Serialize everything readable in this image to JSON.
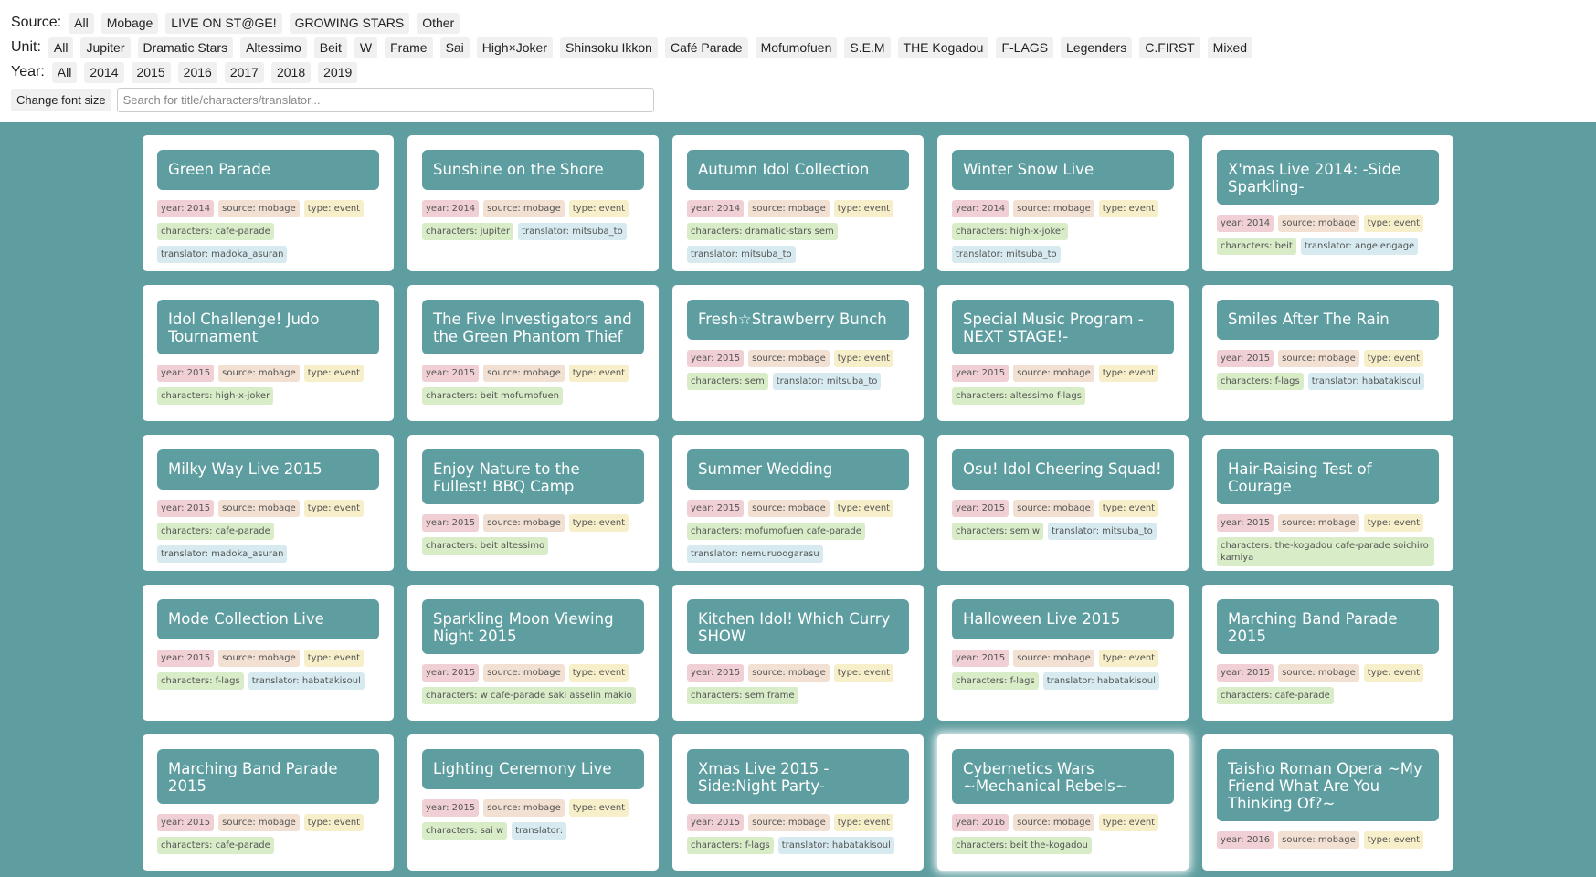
{
  "filters": {
    "source": {
      "label": "Source:",
      "options": [
        "All",
        "Mobage",
        "LIVE ON ST@GE!",
        "GROWING STARS",
        "Other"
      ]
    },
    "unit": {
      "label": "Unit:",
      "options": [
        "All",
        "Jupiter",
        "Dramatic Stars",
        "Altessimo",
        "Beit",
        "W",
        "Frame",
        "Sai",
        "High×Joker",
        "Shinsoku Ikkon",
        "Café Parade",
        "Mofumofuen",
        "S.E.M",
        "THE Kogadou",
        "F-LAGS",
        "Legenders",
        "C.FIRST",
        "Mixed"
      ]
    },
    "year": {
      "label": "Year:",
      "options": [
        "All",
        "2014",
        "2015",
        "2016",
        "2017",
        "2018",
        "2019"
      ]
    }
  },
  "toolbar": {
    "font_size_label": "Change font size",
    "search_placeholder": "Search for title/characters/translator..."
  },
  "cards": [
    {
      "title": "Green Parade",
      "tags": [
        {
          "k": "year",
          "t": "year: 2014"
        },
        {
          "k": "source",
          "t": "source: mobage"
        },
        {
          "k": "type",
          "t": "type: event"
        },
        {
          "k": "characters",
          "t": "characters: cafe-parade"
        },
        {
          "k": "translator",
          "t": "translator: madoka_asuran"
        }
      ]
    },
    {
      "title": "Sunshine on the Shore",
      "tags": [
        {
          "k": "year",
          "t": "year: 2014"
        },
        {
          "k": "source",
          "t": "source: mobage"
        },
        {
          "k": "type",
          "t": "type: event"
        },
        {
          "k": "characters",
          "t": "characters: jupiter"
        },
        {
          "k": "translator",
          "t": "translator: mitsuba_to"
        }
      ]
    },
    {
      "title": "Autumn Idol Collection",
      "tags": [
        {
          "k": "year",
          "t": "year: 2014"
        },
        {
          "k": "source",
          "t": "source: mobage"
        },
        {
          "k": "type",
          "t": "type: event"
        },
        {
          "k": "characters",
          "t": "characters: dramatic-stars sem"
        },
        {
          "k": "translator",
          "t": "translator: mitsuba_to"
        }
      ]
    },
    {
      "title": "Winter Snow Live",
      "tags": [
        {
          "k": "year",
          "t": "year: 2014"
        },
        {
          "k": "source",
          "t": "source: mobage"
        },
        {
          "k": "type",
          "t": "type: event"
        },
        {
          "k": "characters",
          "t": "characters: high-x-joker"
        },
        {
          "k": "translator",
          "t": "translator: mitsuba_to"
        }
      ]
    },
    {
      "title": "X'mas Live 2014: -Side Sparkling-",
      "tags": [
        {
          "k": "year",
          "t": "year: 2014"
        },
        {
          "k": "source",
          "t": "source: mobage"
        },
        {
          "k": "type",
          "t": "type: event"
        },
        {
          "k": "characters",
          "t": "characters: beit"
        },
        {
          "k": "translator",
          "t": "translator: angelengage"
        }
      ]
    },
    {
      "title": "Idol Challenge! Judo Tournament",
      "tags": [
        {
          "k": "year",
          "t": "year: 2015"
        },
        {
          "k": "source",
          "t": "source: mobage"
        },
        {
          "k": "type",
          "t": "type: event"
        },
        {
          "k": "characters",
          "t": "characters: high-x-joker"
        }
      ]
    },
    {
      "title": "The Five Investigators and the Green Phantom Thief",
      "tags": [
        {
          "k": "year",
          "t": "year: 2015"
        },
        {
          "k": "source",
          "t": "source: mobage"
        },
        {
          "k": "type",
          "t": "type: event"
        },
        {
          "k": "characters",
          "t": "characters: beit mofumofuen"
        }
      ]
    },
    {
      "title": "Fresh☆Strawberry Bunch",
      "tags": [
        {
          "k": "year",
          "t": "year: 2015"
        },
        {
          "k": "source",
          "t": "source: mobage"
        },
        {
          "k": "type",
          "t": "type: event"
        },
        {
          "k": "characters",
          "t": "characters: sem"
        },
        {
          "k": "translator",
          "t": "translator: mitsuba_to"
        }
      ]
    },
    {
      "title": "Special Music Program -NEXT STAGE!-",
      "tags": [
        {
          "k": "year",
          "t": "year: 2015"
        },
        {
          "k": "source",
          "t": "source: mobage"
        },
        {
          "k": "type",
          "t": "type: event"
        },
        {
          "k": "characters",
          "t": "characters: altessimo f-lags"
        }
      ]
    },
    {
      "title": "Smiles After The Rain",
      "tags": [
        {
          "k": "year",
          "t": "year: 2015"
        },
        {
          "k": "source",
          "t": "source: mobage"
        },
        {
          "k": "type",
          "t": "type: event"
        },
        {
          "k": "characters",
          "t": "characters: f-lags"
        },
        {
          "k": "translator",
          "t": "translator: habatakisoul"
        }
      ]
    },
    {
      "title": "Milky Way Live 2015",
      "tags": [
        {
          "k": "year",
          "t": "year: 2015"
        },
        {
          "k": "source",
          "t": "source: mobage"
        },
        {
          "k": "type",
          "t": "type: event"
        },
        {
          "k": "characters",
          "t": "characters: cafe-parade"
        },
        {
          "k": "translator",
          "t": "translator: madoka_asuran"
        }
      ]
    },
    {
      "title": "Enjoy Nature to the Fullest! BBQ Camp",
      "tags": [
        {
          "k": "year",
          "t": "year: 2015"
        },
        {
          "k": "source",
          "t": "source: mobage"
        },
        {
          "k": "type",
          "t": "type: event"
        },
        {
          "k": "characters",
          "t": "characters: beit altessimo"
        }
      ]
    },
    {
      "title": "Summer Wedding",
      "tags": [
        {
          "k": "year",
          "t": "year: 2015"
        },
        {
          "k": "source",
          "t": "source: mobage"
        },
        {
          "k": "type",
          "t": "type: event"
        },
        {
          "k": "characters",
          "t": "characters: mofumofuen cafe-parade"
        },
        {
          "k": "translator",
          "t": "translator: nemuruoogarasu"
        }
      ]
    },
    {
      "title": "Osu! Idol Cheering Squad!",
      "tags": [
        {
          "k": "year",
          "t": "year: 2015"
        },
        {
          "k": "source",
          "t": "source: mobage"
        },
        {
          "k": "type",
          "t": "type: event"
        },
        {
          "k": "characters",
          "t": "characters: sem w"
        },
        {
          "k": "translator",
          "t": "translator: mitsuba_to"
        }
      ]
    },
    {
      "title": "Hair-Raising Test of Courage",
      "tags": [
        {
          "k": "year",
          "t": "year: 2015"
        },
        {
          "k": "source",
          "t": "source: mobage"
        },
        {
          "k": "type",
          "t": "type: event"
        },
        {
          "k": "characters",
          "t": "characters: the-kogadou cafe-parade soichiro kamiya"
        }
      ]
    },
    {
      "title": "Mode Collection Live",
      "tags": [
        {
          "k": "year",
          "t": "year: 2015"
        },
        {
          "k": "source",
          "t": "source: mobage"
        },
        {
          "k": "type",
          "t": "type: event"
        },
        {
          "k": "characters",
          "t": "characters: f-lags"
        },
        {
          "k": "translator",
          "t": "translator: habatakisoul"
        }
      ]
    },
    {
      "title": "Sparkling Moon Viewing Night 2015",
      "tags": [
        {
          "k": "year",
          "t": "year: 2015"
        },
        {
          "k": "source",
          "t": "source: mobage"
        },
        {
          "k": "type",
          "t": "type: event"
        },
        {
          "k": "characters",
          "t": "characters: w cafe-parade saki asselin makio"
        }
      ]
    },
    {
      "title": "Kitchen Idol! Which Curry SHOW",
      "tags": [
        {
          "k": "year",
          "t": "year: 2015"
        },
        {
          "k": "source",
          "t": "source: mobage"
        },
        {
          "k": "type",
          "t": "type: event"
        },
        {
          "k": "characters",
          "t": "characters: sem frame"
        }
      ]
    },
    {
      "title": "Halloween Live 2015",
      "tags": [
        {
          "k": "year",
          "t": "year: 2015"
        },
        {
          "k": "source",
          "t": "source: mobage"
        },
        {
          "k": "type",
          "t": "type: event"
        },
        {
          "k": "characters",
          "t": "characters: f-lags"
        },
        {
          "k": "translator",
          "t": "translator: habatakisoul"
        }
      ]
    },
    {
      "title": "Marching Band Parade 2015",
      "tags": [
        {
          "k": "year",
          "t": "year: 2015"
        },
        {
          "k": "source",
          "t": "source: mobage"
        },
        {
          "k": "type",
          "t": "type: event"
        },
        {
          "k": "characters",
          "t": "characters: cafe-parade"
        }
      ]
    },
    {
      "title": "Marching Band Parade 2015",
      "tags": [
        {
          "k": "year",
          "t": "year: 2015"
        },
        {
          "k": "source",
          "t": "source: mobage"
        },
        {
          "k": "type",
          "t": "type: event"
        },
        {
          "k": "characters",
          "t": "characters: cafe-parade"
        }
      ]
    },
    {
      "title": "Lighting Ceremony Live",
      "tags": [
        {
          "k": "year",
          "t": "year: 2015"
        },
        {
          "k": "source",
          "t": "source: mobage"
        },
        {
          "k": "type",
          "t": "type: event"
        },
        {
          "k": "characters",
          "t": "characters: sai w"
        },
        {
          "k": "translator",
          "t": "translator:"
        }
      ]
    },
    {
      "title": "Xmas Live 2015 -Side:Night Party-",
      "tags": [
        {
          "k": "year",
          "t": "year: 2015"
        },
        {
          "k": "source",
          "t": "source: mobage"
        },
        {
          "k": "type",
          "t": "type: event"
        },
        {
          "k": "characters",
          "t": "characters: f-lags"
        },
        {
          "k": "translator",
          "t": "translator: habatakisoul"
        }
      ]
    },
    {
      "title": "Cybernetics Wars ~Mechanical Rebels~",
      "glow": true,
      "tags": [
        {
          "k": "year",
          "t": "year: 2016"
        },
        {
          "k": "source",
          "t": "source: mobage"
        },
        {
          "k": "type",
          "t": "type: event"
        },
        {
          "k": "characters",
          "t": "characters: beit the-kogadou"
        }
      ]
    },
    {
      "title": "Taisho Roman Opera ~My Friend What Are You Thinking Of?~",
      "tags": [
        {
          "k": "year",
          "t": "year: 2016"
        },
        {
          "k": "source",
          "t": "source: mobage"
        },
        {
          "k": "type",
          "t": "type: event"
        }
      ]
    }
  ]
}
